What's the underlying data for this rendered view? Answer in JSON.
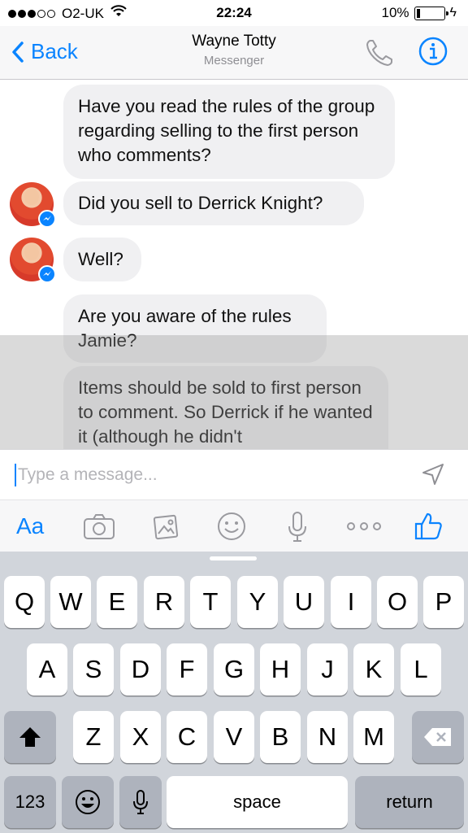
{
  "status_bar": {
    "carrier": "O2-UK",
    "time": "22:24",
    "battery": "10%",
    "battery_level": 0.1,
    "signal_dots_filled": 3,
    "signal_dots_total": 5
  },
  "header": {
    "back_label": "Back",
    "title": "Wayne Totty",
    "subtitle": "Messenger",
    "icons": [
      "phone-icon",
      "info-icon"
    ]
  },
  "messages": [
    {
      "text": "Have you read the rules of the group regarding selling to the first person who comments?"
    },
    {
      "text": "Did you sell to Derrick Knight?"
    },
    {
      "text": "Well?"
    },
    {
      "text": "Are you aware of the rules Jamie?"
    },
    {
      "text": "Items should be sold to first person to comment. So Derrick if he wanted it (although he didn't"
    }
  ],
  "composer": {
    "placeholder": "Type a message..."
  },
  "toolbar": {
    "aa_label": "Aa",
    "icons": [
      "camera-icon",
      "gallery-icon",
      "smiley-icon",
      "microphone-icon",
      "more-icon",
      "like-icon"
    ]
  },
  "keyboard": {
    "row1": [
      "Q",
      "W",
      "E",
      "R",
      "T",
      "Y",
      "U",
      "I",
      "O",
      "P"
    ],
    "row2": [
      "A",
      "S",
      "D",
      "F",
      "G",
      "H",
      "J",
      "K",
      "L"
    ],
    "row3": [
      "Z",
      "X",
      "C",
      "V",
      "B",
      "N",
      "M"
    ],
    "numbers_label": "123",
    "space_label": "space",
    "return_label": "return"
  },
  "colors": {
    "accent": "#0a84ff",
    "bubble": "#f0f0f2",
    "keyboard_bg": "#d1d5db"
  }
}
